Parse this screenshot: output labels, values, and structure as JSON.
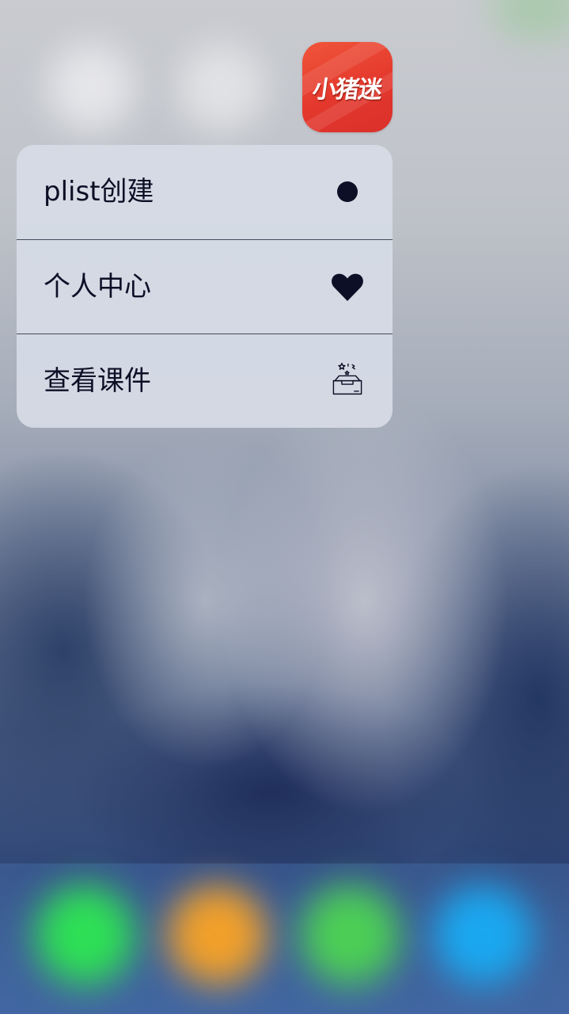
{
  "app": {
    "name_logo": "小猪迷",
    "brand_color": "#e4382d"
  },
  "quick_actions": [
    {
      "label": "plist创建",
      "icon": "filled-circle-icon"
    },
    {
      "label": "个人中心",
      "icon": "heart-icon"
    },
    {
      "label": "查看课件",
      "icon": "open-box-icon"
    }
  ],
  "colors": {
    "menu_text": "#0d0f26",
    "menu_background": "#d6dce6",
    "dock_app_1": "#2ee055",
    "dock_app_2": "#f2a02a",
    "dock_app_3": "#4ccf55",
    "dock_app_4": "#1aa8f0"
  }
}
